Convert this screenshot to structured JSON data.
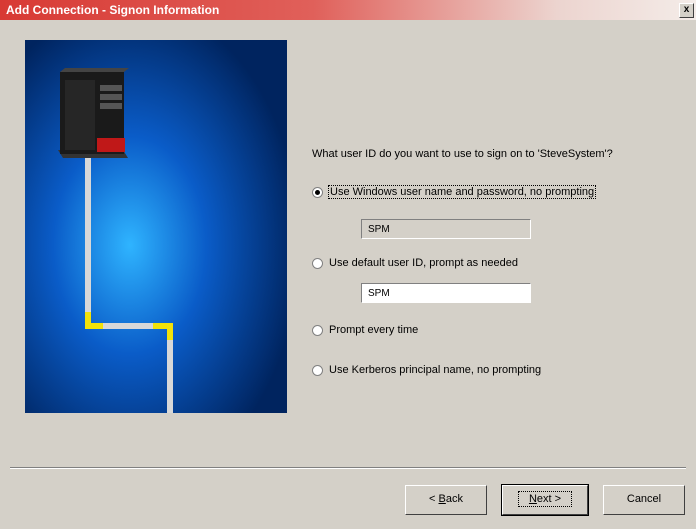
{
  "window": {
    "title": "Add Connection - Signon Information",
    "close_glyph": "x"
  },
  "question": "What user ID do you want to use to sign on to 'SteveSystem'?",
  "options": [
    {
      "label": "Use Windows user name and password, no prompting",
      "checked": true
    },
    {
      "label": "Use default user ID, prompt as needed",
      "checked": false
    },
    {
      "label": "Prompt every time",
      "checked": false
    },
    {
      "label": "Use Kerberos principal name, no prompting",
      "checked": false
    }
  ],
  "fields": {
    "windows_user": "SPM",
    "default_user": "SPM"
  },
  "buttons": {
    "back_prefix": "< ",
    "back_key": "B",
    "back_rest": "ack",
    "next_key": "N",
    "next_rest": "ext >",
    "cancel": "Cancel"
  },
  "colors": {
    "title_start": "#d83a34",
    "illustration_bg": "#003a8c",
    "cable": "#cfcfcf",
    "elbow": "#f2e20a"
  }
}
